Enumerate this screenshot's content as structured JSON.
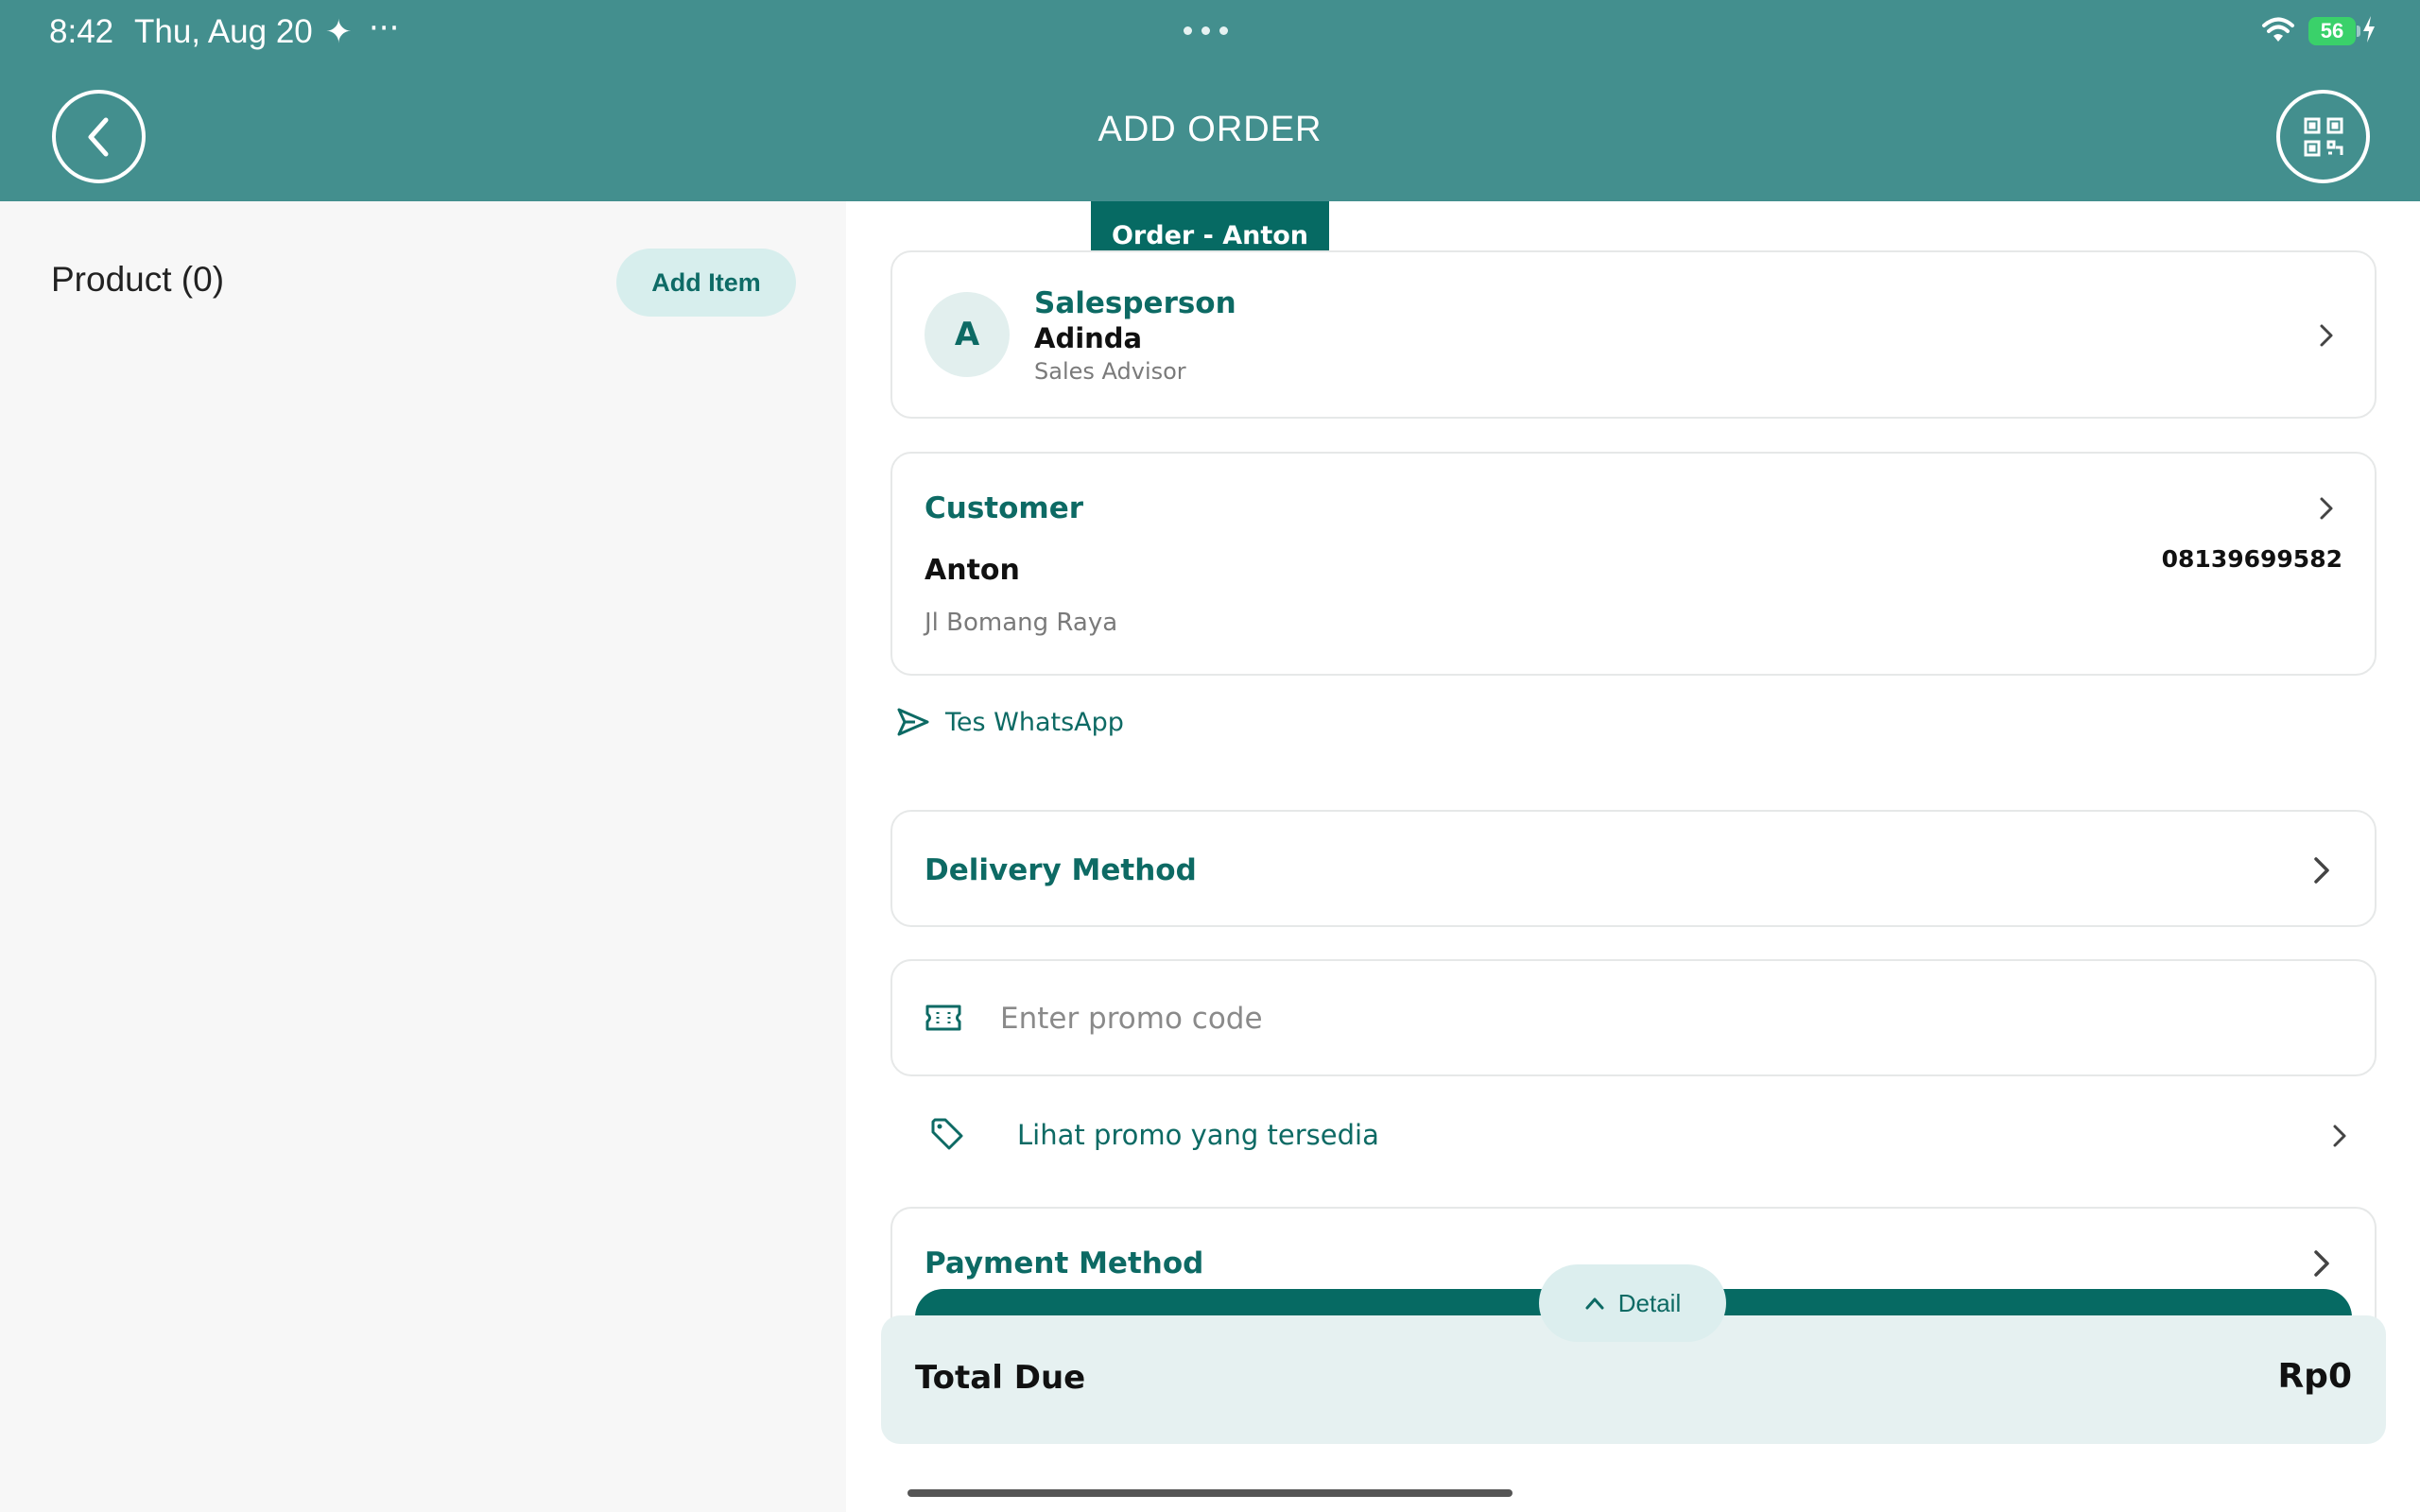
{
  "status_bar": {
    "time": "8:42",
    "date": "Thu, Aug 20",
    "battery": "56"
  },
  "header": {
    "title": "ADD ORDER"
  },
  "left_pane": {
    "product_title": "Product (0)",
    "add_item_label": "Add Item"
  },
  "order_tab": "Order - Anton",
  "salesperson": {
    "avatar_initial": "A",
    "label": "Salesperson",
    "name": "Adinda",
    "role": "Sales Advisor"
  },
  "customer": {
    "label": "Customer",
    "name": "Anton",
    "phone": "08139699582",
    "address": "Jl Bomang Raya"
  },
  "whatsapp_label": "Tes WhatsApp",
  "delivery_label": "Delivery Method",
  "promo": {
    "placeholder": "Enter promo code",
    "link_label": "Lihat promo yang tersedia"
  },
  "payment_label": "Payment Method",
  "detail_label": "Detail",
  "total": {
    "label": "Total Due",
    "value": "Rp0"
  },
  "colors": {
    "header": "#438f8e",
    "accent": "#066a63",
    "panel": "#e6f1f1"
  }
}
